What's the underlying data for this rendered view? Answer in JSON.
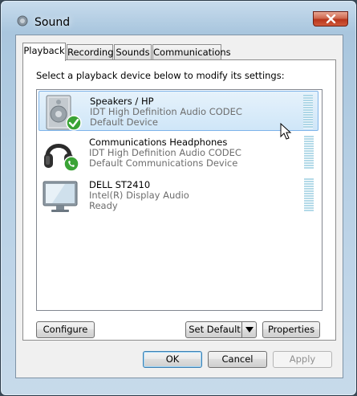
{
  "window": {
    "title": "Sound"
  },
  "tabs": [
    {
      "label": "Playback",
      "active": true
    },
    {
      "label": "Recording",
      "active": false
    },
    {
      "label": "Sounds",
      "active": false
    },
    {
      "label": "Communications",
      "active": false
    }
  ],
  "playback": {
    "instructions": "Select a playback device below to modify its settings:",
    "devices": [
      {
        "name": "Speakers / HP",
        "line1": "IDT High Definition Audio CODEC",
        "line2": "Default Device",
        "icon": "speaker-icon",
        "badge": "check-badge-icon",
        "selected": true
      },
      {
        "name": "Communications Headphones",
        "line1": "IDT High Definition Audio CODEC",
        "line2": "Default Communications Device",
        "icon": "headphones-icon",
        "badge": "phone-badge-icon",
        "selected": false
      },
      {
        "name": "DELL ST2410",
        "line1": "Intel(R) Display Audio",
        "line2": "Ready",
        "icon": "monitor-icon",
        "badge": "",
        "selected": false
      }
    ],
    "configure_label": "Configure",
    "set_default_label": "Set Default",
    "properties_label": "Properties"
  },
  "footer": {
    "ok_label": "OK",
    "cancel_label": "Cancel",
    "apply_label": "Apply"
  },
  "colors": {
    "selection_border": "#7eb4ea",
    "selection_fill": "#cfe6f8",
    "meter": "#a7d3e4",
    "check_green": "#3aa335"
  }
}
